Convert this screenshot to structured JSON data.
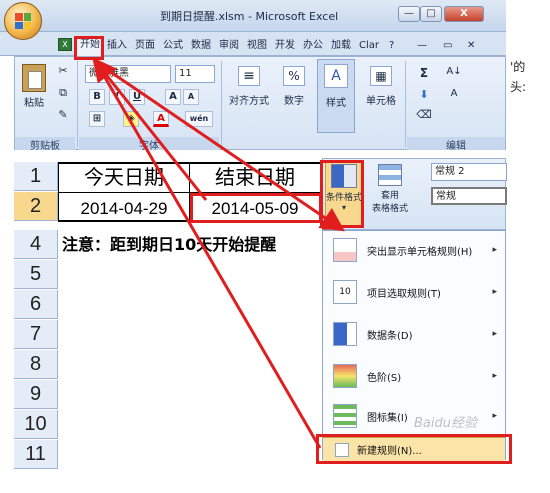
{
  "window": {
    "title": "到期日提醒.xlsm - Microsoft Excel",
    "minimize": "—",
    "maximize": "□",
    "close": "X"
  },
  "tabs": [
    "开始",
    "插入",
    "页面",
    "公式",
    "数据",
    "审阅",
    "视图",
    "开发",
    "办公",
    "加载",
    "Clar"
  ],
  "tab_extras": {
    "help": "?",
    "minimize": "—",
    "restore": "▭",
    "close": "✕"
  },
  "ribbon": {
    "paste_label": "粘贴",
    "font_name": "微软雅黑",
    "font_size": "11",
    "bold": "B",
    "italic": "I",
    "underline": "U",
    "grow": "A",
    "shrink": "A",
    "wen": "wén",
    "align_label": "对齐方式",
    "number_label": "数字",
    "style_label": "样式",
    "cells_label": "单元格",
    "groups": {
      "clipboard": "剪贴板",
      "font": "字体",
      "editing": "编辑"
    },
    "sum": "Σ",
    "sort": "A↓",
    "find": "A"
  },
  "sheet": {
    "rows": [
      "1",
      "2",
      "4",
      "5",
      "6",
      "7",
      "8",
      "9",
      "10",
      "11"
    ],
    "a1": "今天日期",
    "b1": "结束日期",
    "a2": "2014-04-29",
    "b2": "2014-05-09",
    "a4": "注意：距到期日10天开始提醒"
  },
  "cf_panel": {
    "conditional_format": "条件格式",
    "table_format_line1": "套用",
    "table_format_line2": "表格格式",
    "style_normal2": "常规 2",
    "style_normal": "常规"
  },
  "menu": {
    "items": [
      {
        "label": "突出显示单元格规则(H)",
        "has_sub": "▸"
      },
      {
        "label": "项目选取规则(T)",
        "has_sub": "▸"
      },
      {
        "label": "数据条(D)",
        "has_sub": "▸"
      },
      {
        "label": "色阶(S)",
        "has_sub": "▸"
      },
      {
        "label": "图标集(I)",
        "has_sub": "▸"
      }
    ],
    "new_rule": "新建规则(N)..."
  },
  "edge_text": [
    "'的",
    "头:"
  ],
  "watermark": "Baidu经验",
  "colors": {
    "highlight": "#e01e1e",
    "ribbon": "#d7e4f4",
    "selected_header": "#f8d88c"
  }
}
